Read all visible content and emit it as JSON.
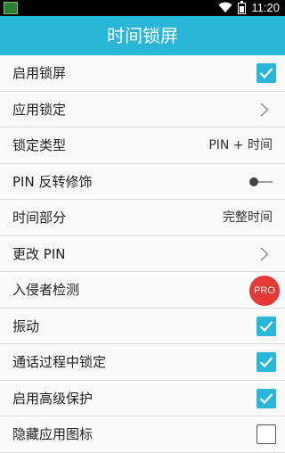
{
  "status_bar": {
    "time": "11:20",
    "icons": [
      "app-notification-icon",
      "wifi-icon",
      "battery-icon"
    ]
  },
  "header": {
    "title": "时间锁屏"
  },
  "colors": {
    "accent": "#29b6d8",
    "pro_badge": "#e53935"
  },
  "settings": [
    {
      "label": "启用锁屏",
      "control": "checkbox",
      "checked": true
    },
    {
      "label": "应用锁定",
      "control": "chevron"
    },
    {
      "label": "锁定类型",
      "control": "value",
      "value": "PIN + 时间"
    },
    {
      "label": "PIN 反转修饰",
      "control": "toggle",
      "on": false
    },
    {
      "label": "时间部分",
      "control": "value",
      "value": "完整时间"
    },
    {
      "label": "更改 PIN",
      "control": "chevron"
    },
    {
      "label": "入侵者检测",
      "control": "badge",
      "badge": "PRO"
    },
    {
      "label": "振动",
      "control": "checkbox",
      "checked": true
    },
    {
      "label": "通话过程中锁定",
      "control": "checkbox",
      "checked": true
    },
    {
      "label": "启用高级保护",
      "control": "checkbox",
      "checked": true
    },
    {
      "label": "隐藏应用图标",
      "control": "checkbox",
      "checked": false
    }
  ]
}
